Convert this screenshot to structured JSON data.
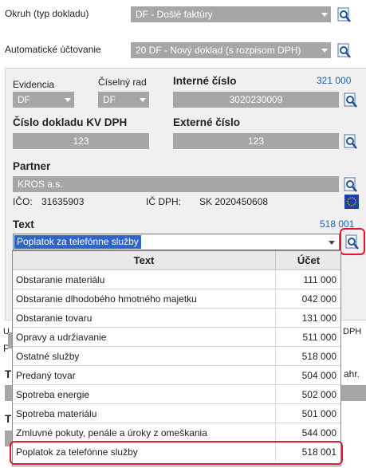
{
  "okruh": {
    "label": "Okruh (typ dokladu)",
    "value": "DF - Došlé faktúry"
  },
  "auto_uctovanie": {
    "label": "Automatické účtovanie",
    "value": "20 DF - Nový doklad (s rozpisom DPH)"
  },
  "evidencia": {
    "label": "Evidencia",
    "value": "DF"
  },
  "ciselny_rad": {
    "label": "Číselný rad",
    "value": "DF"
  },
  "interne_cislo": {
    "label": "Interné číslo",
    "account": "321 000",
    "value": "3020230009"
  },
  "cislo_kv": {
    "label": "Číslo dokladu KV DPH",
    "value": "123"
  },
  "externe_cislo": {
    "label": "Externé číslo",
    "value": "123"
  },
  "partner": {
    "label": "Partner",
    "value": "KROS a.s.",
    "ico_label": "IČO:",
    "ico": "31635903",
    "icdph_label": "IČ DPH:",
    "icdph": "SK 2020450608"
  },
  "text": {
    "label": "Text",
    "account": "518 001",
    "value": "Poplatok za telefónne služby"
  },
  "dropdown": {
    "col_text": "Text",
    "col_ucet": "Účet",
    "rows": [
      {
        "text": "Obstaranie materiálu",
        "ucet": "111 000"
      },
      {
        "text": "Obstaranie dlhodobého hmotného majetku",
        "ucet": "042 000"
      },
      {
        "text": "Obstaranie tovaru",
        "ucet": "131 000"
      },
      {
        "text": "Opravy a udržiavanie",
        "ucet": "511 000"
      },
      {
        "text": "Ostatné služby",
        "ucet": "518 000"
      },
      {
        "text": "Predaný tovar",
        "ucet": "504 000"
      },
      {
        "text": "Spotreba energie",
        "ucet": "502 000"
      },
      {
        "text": "Spotreba materiálu",
        "ucet": "501 000"
      },
      {
        "text": "Zmluvné pokuty, penále a úroky z omeškania",
        "ucet": "544 000"
      },
      {
        "text": "Poplatok za telefónne služby",
        "ucet": "518 001"
      }
    ]
  },
  "behind": {
    "tab_left": "U",
    "tab_right": "DPH",
    "p": "P",
    "t1": "T",
    "t2": "T",
    "ahr": "ahr."
  },
  "colors": {
    "field_bg": "#a6a6a6",
    "accent_blue": "#2f64c9",
    "highlight_red": "#e0192b"
  },
  "icons": {
    "lookup": "magnifier-lookup-icon",
    "eu": "eu-flag-icon"
  }
}
